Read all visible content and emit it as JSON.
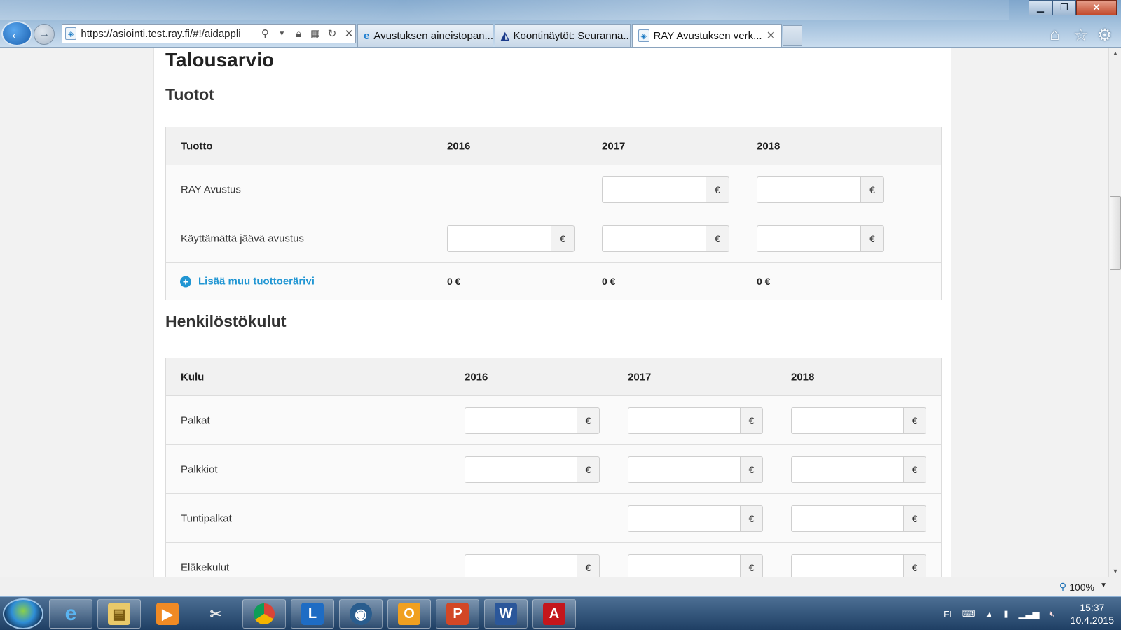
{
  "browser": {
    "address": "https://asiointi.test.ray.fi/#!/aidappli",
    "tabs": [
      {
        "label": "Avustuksen aineistopan..."
      },
      {
        "label": "Koontinäytöt: Seuranna..."
      },
      {
        "label": "RAY Avustuksen verk..."
      }
    ],
    "zoom": "100%"
  },
  "page": {
    "title": "Talousarvio",
    "income_section": {
      "title": "Tuotot",
      "headers": [
        "Tuotto",
        "2016",
        "2017",
        "2018"
      ],
      "rows": [
        {
          "label": "RAY Avustus"
        },
        {
          "label": "Käyttämättä jäävä avustus"
        }
      ],
      "add_link": "Lisää muu tuottoerärivi",
      "totals": [
        "0 €",
        "0 €",
        "0 €"
      ],
      "currency": "€"
    },
    "staff_section": {
      "title": "Henkilöstökulut",
      "headers": [
        "Kulu",
        "2016",
        "2017",
        "2018"
      ],
      "rows": [
        {
          "label": "Palkat"
        },
        {
          "label": "Palkkiot"
        },
        {
          "label": "Tuntipalkat"
        },
        {
          "label": "Eläkekulut"
        }
      ],
      "currency": "€"
    }
  },
  "taskbar": {
    "language": "FI",
    "time": "15:37",
    "date": "10.4.2015"
  },
  "colors": {
    "link": "#2196d3",
    "accent": "#1a5fae"
  }
}
